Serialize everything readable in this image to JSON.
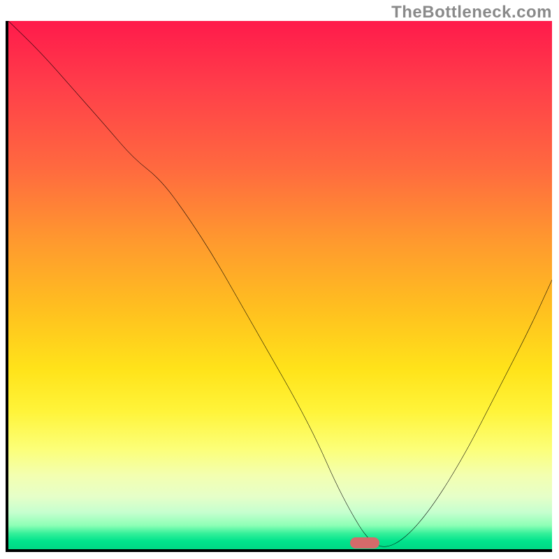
{
  "watermark": "TheBottleneck.com",
  "chart_data": {
    "type": "line",
    "title": "",
    "xlabel": "",
    "ylabel": "",
    "xlim": [
      0,
      100
    ],
    "ylim": [
      0,
      100
    ],
    "grid": false,
    "legend": false,
    "note": "Axes are unlabeled; values are read as percentages of plot width/height, with y=0 at the bottom axis and y=100 at the top.",
    "series": [
      {
        "name": "curve",
        "x": [
          0,
          6,
          12,
          18,
          23,
          28,
          33,
          38,
          43,
          48,
          53,
          57,
          60,
          63,
          66,
          69,
          73,
          78,
          84,
          90,
          96,
          100
        ],
        "y": [
          100,
          94,
          87,
          80,
          74,
          70,
          63,
          55,
          46,
          37,
          28,
          20,
          13,
          7,
          2,
          0,
          2,
          8,
          18,
          30,
          42,
          51
        ]
      }
    ],
    "marker": {
      "name": "bottleneck-point",
      "x_pct": 65.5,
      "y_pct": 1.2,
      "color": "#d46a6a"
    },
    "background_gradient": {
      "type": "vertical",
      "stops": [
        {
          "pct": 0,
          "color": "#ff1a4b"
        },
        {
          "pct": 12,
          "color": "#ff3d4a"
        },
        {
          "pct": 28,
          "color": "#ff6a3f"
        },
        {
          "pct": 42,
          "color": "#ff9a2e"
        },
        {
          "pct": 55,
          "color": "#ffc11f"
        },
        {
          "pct": 66,
          "color": "#ffe31a"
        },
        {
          "pct": 74,
          "color": "#fff43a"
        },
        {
          "pct": 81,
          "color": "#fcff78"
        },
        {
          "pct": 86,
          "color": "#f3ffb0"
        },
        {
          "pct": 90,
          "color": "#e6ffc8"
        },
        {
          "pct": 93,
          "color": "#c6ffcf"
        },
        {
          "pct": 95.5,
          "color": "#8dffb6"
        },
        {
          "pct": 97,
          "color": "#36f09a"
        },
        {
          "pct": 98.5,
          "color": "#00e38c"
        },
        {
          "pct": 100,
          "color": "#00d885"
        }
      ]
    }
  }
}
